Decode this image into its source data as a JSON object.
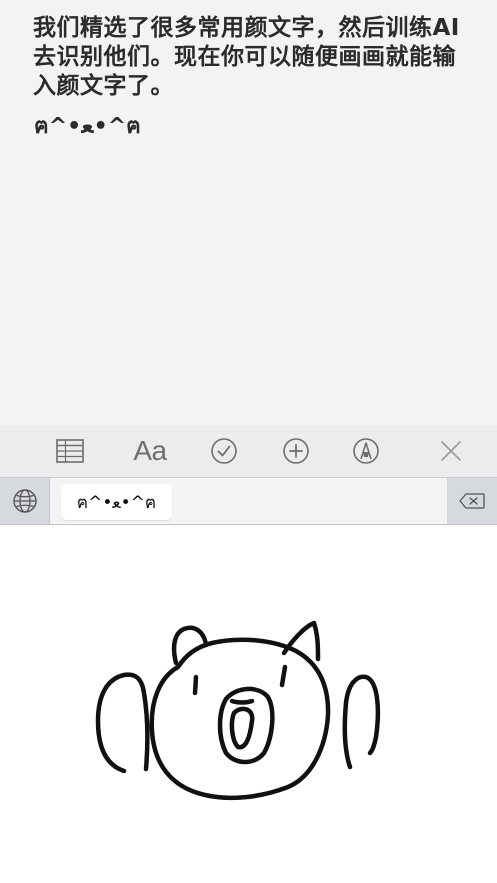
{
  "note": {
    "text": "我们精选了很多常用颜文字，然后训练AI去识别他们。现在你可以随便画画就能输入颜文字了。",
    "emoticon": "ฅ^•ﻌ•^ฅ"
  },
  "toolbar": {
    "items": [
      {
        "icon": "table-icon"
      },
      {
        "label": "Aa",
        "icon": "text-format-icon"
      },
      {
        "icon": "checklist-icon"
      },
      {
        "icon": "add-icon"
      },
      {
        "icon": "markup-pen-icon"
      },
      {
        "icon": "close-icon"
      }
    ]
  },
  "keyboard": {
    "globe_icon": "globe-icon",
    "candidate": "ฅ^•ﻌ•^ฅ",
    "delete_icon": "delete-backspace-icon"
  },
  "colors": {
    "note_bg": "#f3f3f3",
    "toolbar_bg": "#ececee",
    "icon_gray": "#6e6e6e",
    "keyboard_bg": "#d6d9de",
    "ink": "#111111"
  }
}
